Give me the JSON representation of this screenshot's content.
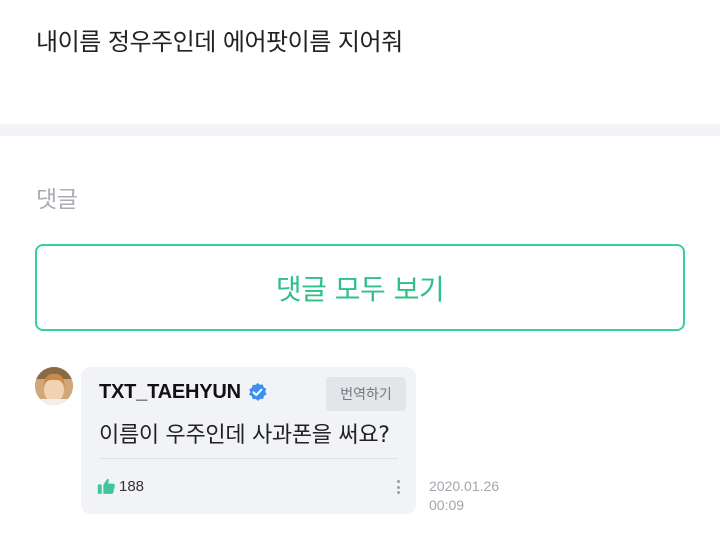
{
  "post": {
    "text": "내이름 정우주인데 에어팟이름 지어줘"
  },
  "comments_section": {
    "title": "댓글",
    "view_all_label": "댓글 모두 보기"
  },
  "comment": {
    "author": "TXT_TAEHYUN",
    "translate_label": "번역하기",
    "text": "이름이 우주인데 사과폰을 써요?",
    "like_count": "188",
    "date": "2020.01.26",
    "time": "00:09"
  },
  "colors": {
    "accent": "#39cf9a",
    "verified": "#3d8ef0",
    "band": "#f3f4f7",
    "bubble": "#f2f3f6",
    "like_icon": "#3fc79a"
  },
  "icons": {
    "verified": "verified-badge-icon",
    "like": "thumbs-up-icon",
    "more": "more-vertical-icon"
  }
}
